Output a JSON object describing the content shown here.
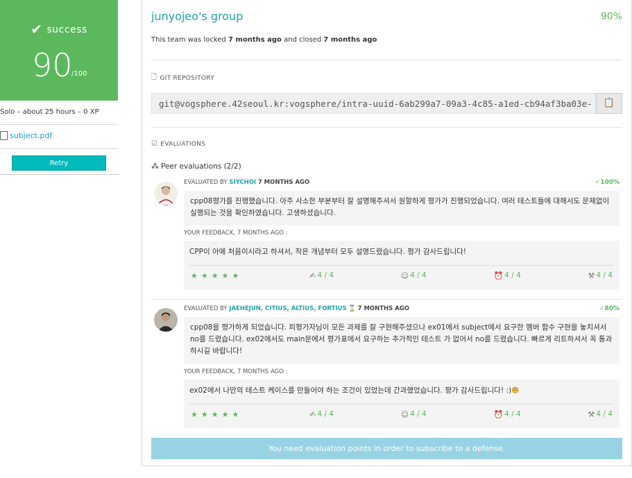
{
  "sidebar": {
    "status_label": "success",
    "score": "90",
    "score_max": "/100",
    "solo_line": "Solo – about 25 hours – 0 XP",
    "subject_link": "subject.pdf",
    "retry_label": "Retry",
    "status_color": "#5cb85c",
    "retry_color": "#00babc"
  },
  "header": {
    "title": "junyojeo's group",
    "percent": "90%",
    "lock_prefix": "This team was locked",
    "lock_time": "7 months ago",
    "lock_middle": "and closed",
    "close_time": "7 months ago"
  },
  "repo": {
    "label": "GIT REPOSITORY",
    "url": "git@vogsphere.42seoul.kr:vogsphere/intra-uuid-6ab299a7-09a3-4c85-a1ed-cb94af3ba03e-"
  },
  "evaluations": {
    "label": "EVALUATIONS",
    "peer_title": "Peer evaluations (2/2)",
    "items": [
      {
        "by_prefix": "EVALUATED BY",
        "evaluator": "SIYCHOI",
        "when": "7 MONTHS AGO",
        "mark": "100%",
        "comment": "cpp08평가를 진행했습니다. 아주 사소한 부분부터 잘 설명해주셔서 원할하게 평가가 진행되었습니다. 여러 테스트들에 대해서도 문제없이 실행되는 것을 확인하였습니다. 고생하셨습니다.",
        "feedback_label": "YOUR FEEDBACK, 7 MONTHS AGO :",
        "feedback": "CPP이 아예 처음이시라고 하셔서, 작은 개념부터 모두 설명드렸습니다. 평가 감사드립니다!",
        "stars": [
          "★",
          "★",
          "★",
          "★",
          "★"
        ],
        "metrics": [
          "4 / 4",
          "4 / 4",
          "4 / 4",
          "4 / 4"
        ]
      },
      {
        "by_prefix": "EVALUATED BY",
        "evaluator": "JAEHEJUN, CITIUS, ALTIUS, FORTIUS",
        "when": "7 MONTHS AGO",
        "mark": "80%",
        "comment": "cpp08을 평가하게 되었습니다. 피평가자님이 모든 과제를 잘 구현해주셨으나 ex01에서 subject에서 요구한 멤버 함수 구현을 놓치셔서 no를 드렸습니다. ex02에서도 main문에서 평가표에서 요구하는 추가적인 테스트 가 없어서 no를 드렸습니다. 빠르게 리트하셔서 꼭 통과하시길 바랍니다!",
        "feedback_label": "YOUR FEEDBACK, 7 MONTHS AGO :",
        "feedback": "ex02에서 나만의 테스트 케이스를 만들어야 하는 조건이 있었는데 간과했었습니다. 평가 감사드립니다! :)",
        "stars": [
          "★",
          "★",
          "★",
          "★",
          "★"
        ],
        "metrics": [
          "4 / 4",
          "4 / 4",
          "4 / 4",
          "4 / 4"
        ]
      }
    ]
  },
  "defense_notice": "You need evaluation points in order to subscribe to a defense."
}
